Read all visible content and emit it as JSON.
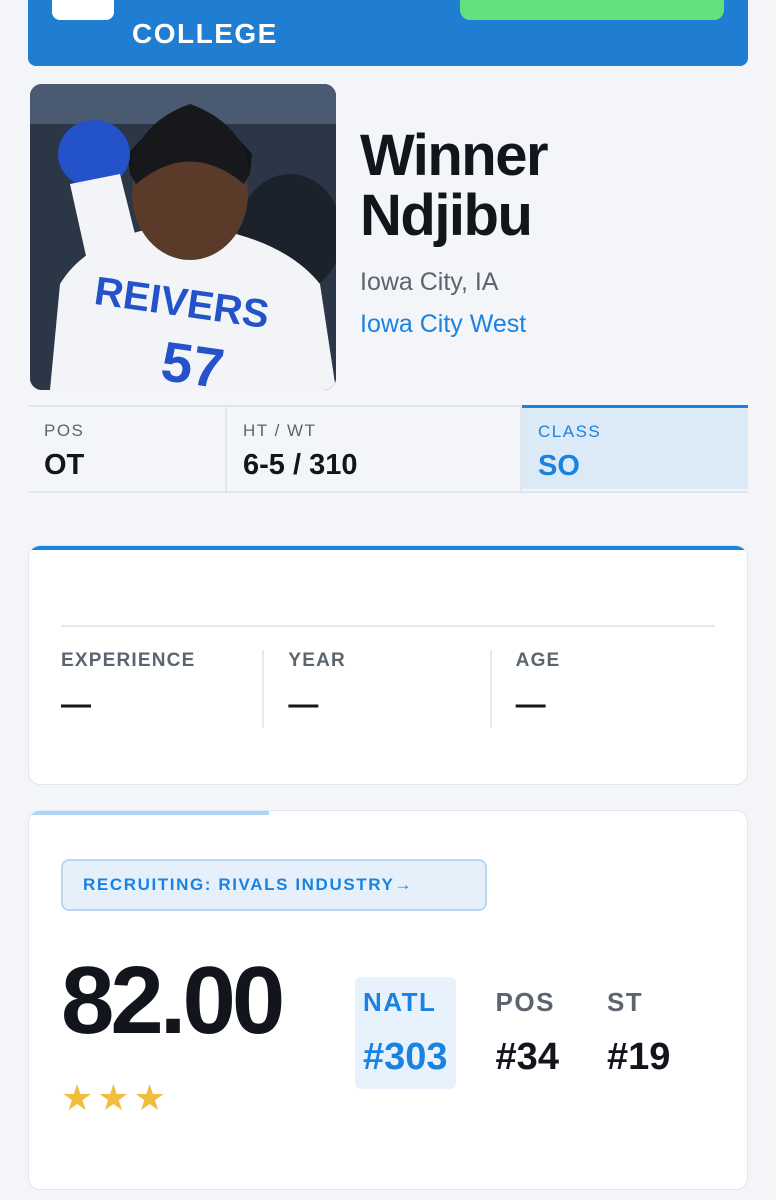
{
  "banner": {
    "label": "COLLEGE"
  },
  "player": {
    "first_name": "Winner",
    "last_name": "Ndjibu",
    "hometown": "Iowa City, IA",
    "school": "Iowa City West",
    "photo_jersey_text": "REIVERS",
    "photo_jersey_number": "57"
  },
  "vitals": [
    {
      "label": "POS",
      "value": "OT"
    },
    {
      "label": "HT / WT",
      "value": "6-5 / 310"
    },
    {
      "label": "CLASS",
      "value": "SO"
    }
  ],
  "experience": {
    "cols": [
      {
        "label": "EXPERIENCE",
        "value": "—"
      },
      {
        "label": "YEAR",
        "value": "—"
      },
      {
        "label": "AGE",
        "value": "—"
      }
    ]
  },
  "recruiting": {
    "source_label": "RECRUITING: RIVALS INDUSTRY→",
    "score": "82.00",
    "stars": 3,
    "stars_text": "★★★",
    "ranks": [
      {
        "label": "NATL",
        "value": "#303"
      },
      {
        "label": "POS",
        "value": "#34"
      },
      {
        "label": "ST",
        "value": "#19"
      }
    ]
  },
  "colors": {
    "accent": "#1a82e0",
    "banner": "#1f7ed1",
    "cta": "#63e07e",
    "star": "#f0bd3c"
  }
}
